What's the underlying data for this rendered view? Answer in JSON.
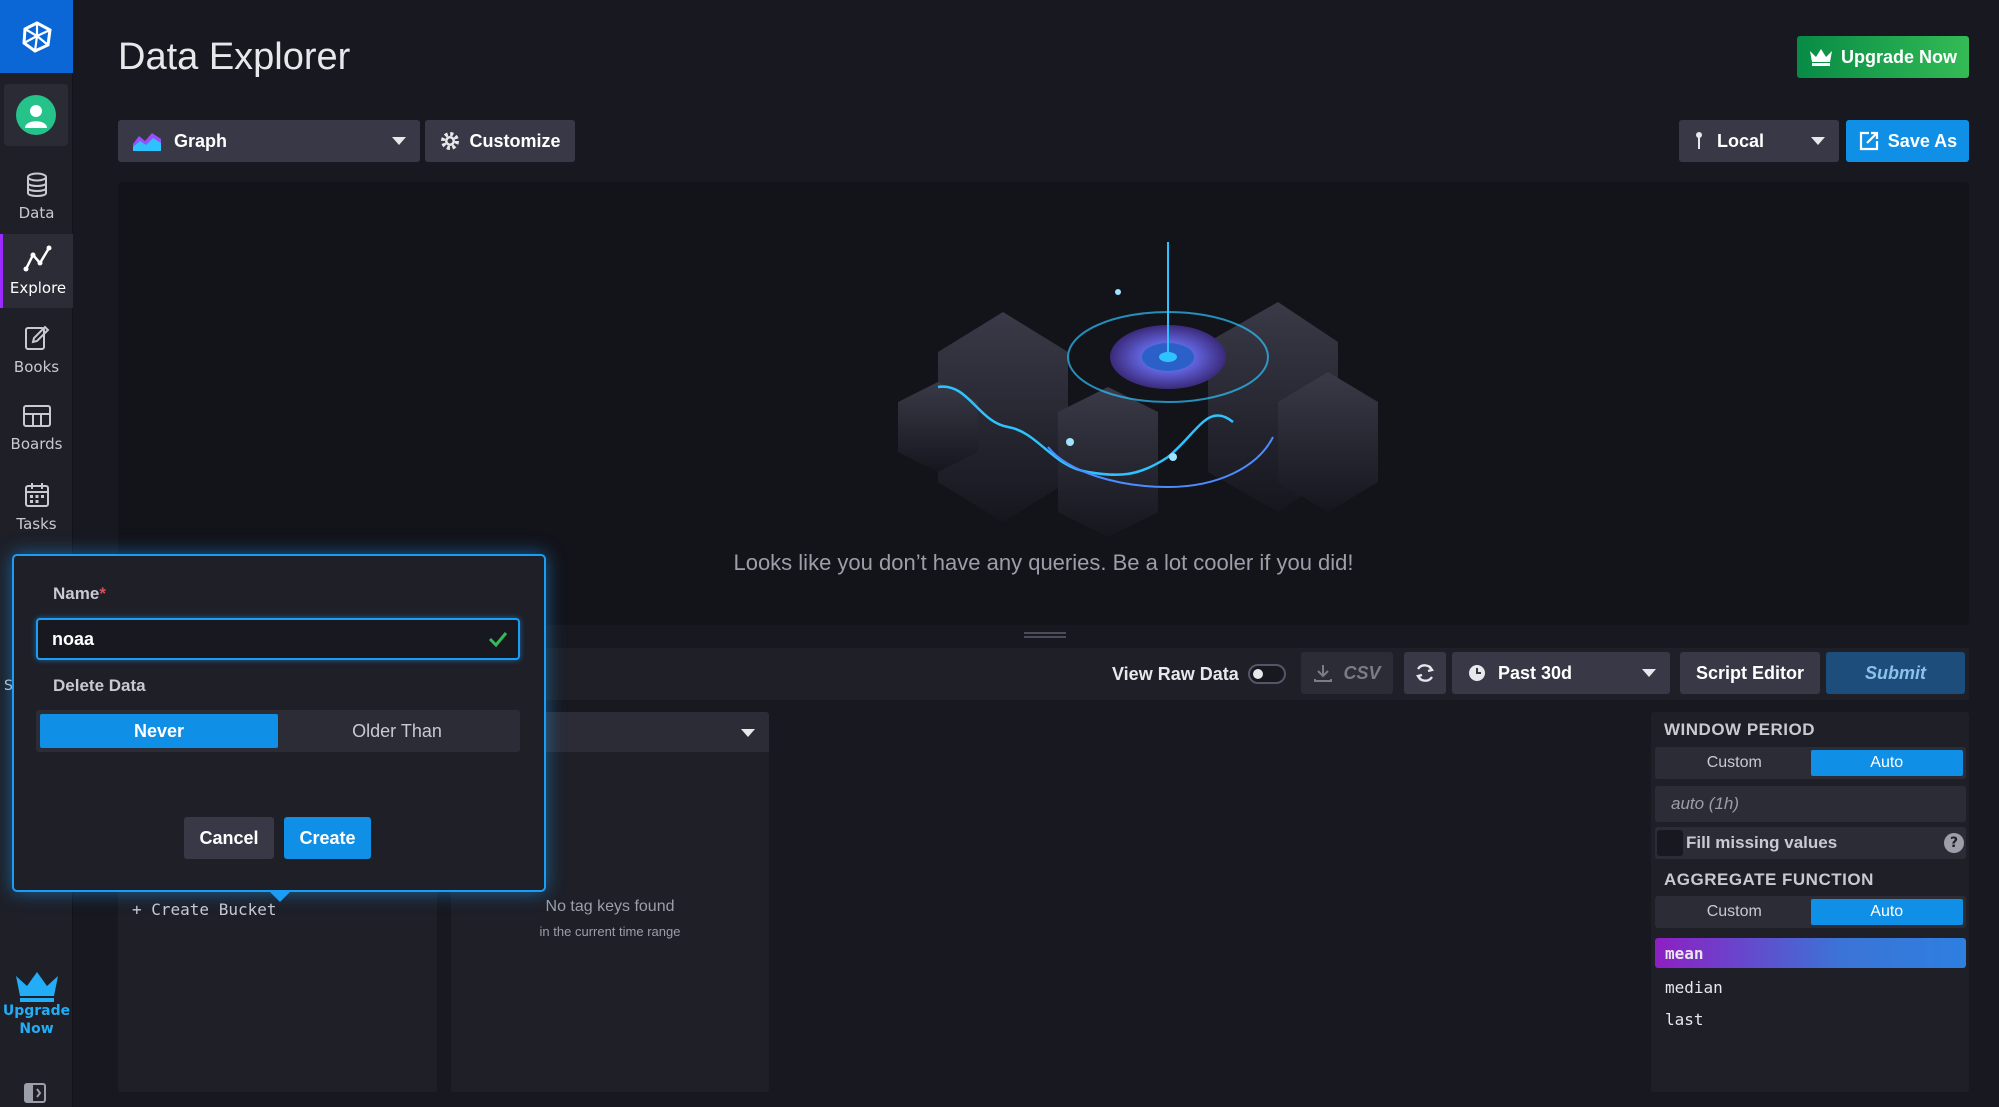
{
  "page": {
    "title": "Data Explorer"
  },
  "colors": {
    "accent": "#0f8fe6",
    "upgrade": "#34bb55",
    "active_nav": "#9b2aff"
  },
  "sidebar": {
    "items": [
      {
        "label": "Data",
        "icon": "database-icon"
      },
      {
        "label": "Explore",
        "icon": "explore-graph-icon",
        "active": true
      },
      {
        "label": "Books",
        "icon": "notebook-icon"
      },
      {
        "label": "Boards",
        "icon": "dashboard-grid-icon"
      },
      {
        "label": "Tasks",
        "icon": "calendar-icon"
      }
    ],
    "partial_label": "S",
    "upgrade_line1": "Upgrade",
    "upgrade_line2": "Now"
  },
  "header": {
    "upgrade_label": "Upgrade Now",
    "vis_type": "Graph",
    "customize_label": "Customize",
    "timezone": "Local",
    "save_as_label": "Save As"
  },
  "graph": {
    "empty_message": "Looks like you don’t have any queries. Be a lot cooler if you did!"
  },
  "query_toolbar": {
    "view_raw_label": "View Raw Data",
    "view_raw_on": false,
    "csv_label": "CSV",
    "time_range": "Past 30d",
    "script_editor_label": "Script Editor",
    "submit_label": "Submit"
  },
  "builder": {
    "create_bucket_label": "+ Create Bucket",
    "no_tags_title": "No tag keys found",
    "no_tags_sub": "in the current time range"
  },
  "functions": {
    "window_period_heading": "WINDOW PERIOD",
    "window_custom": "Custom",
    "window_auto": "Auto",
    "window_value": "auto (1h)",
    "fill_missing_label": "Fill missing values",
    "aggregate_heading": "AGGREGATE FUNCTION",
    "agg_custom": "Custom",
    "agg_auto": "Auto",
    "items": [
      "mean",
      "median",
      "last"
    ],
    "selected": "mean"
  },
  "create_bucket_form": {
    "name_label": "Name",
    "required_mark": "*",
    "name_value": "noaa",
    "delete_label": "Delete Data",
    "retention_never": "Never",
    "retention_older": "Older Than",
    "cancel_label": "Cancel",
    "create_label": "Create"
  }
}
